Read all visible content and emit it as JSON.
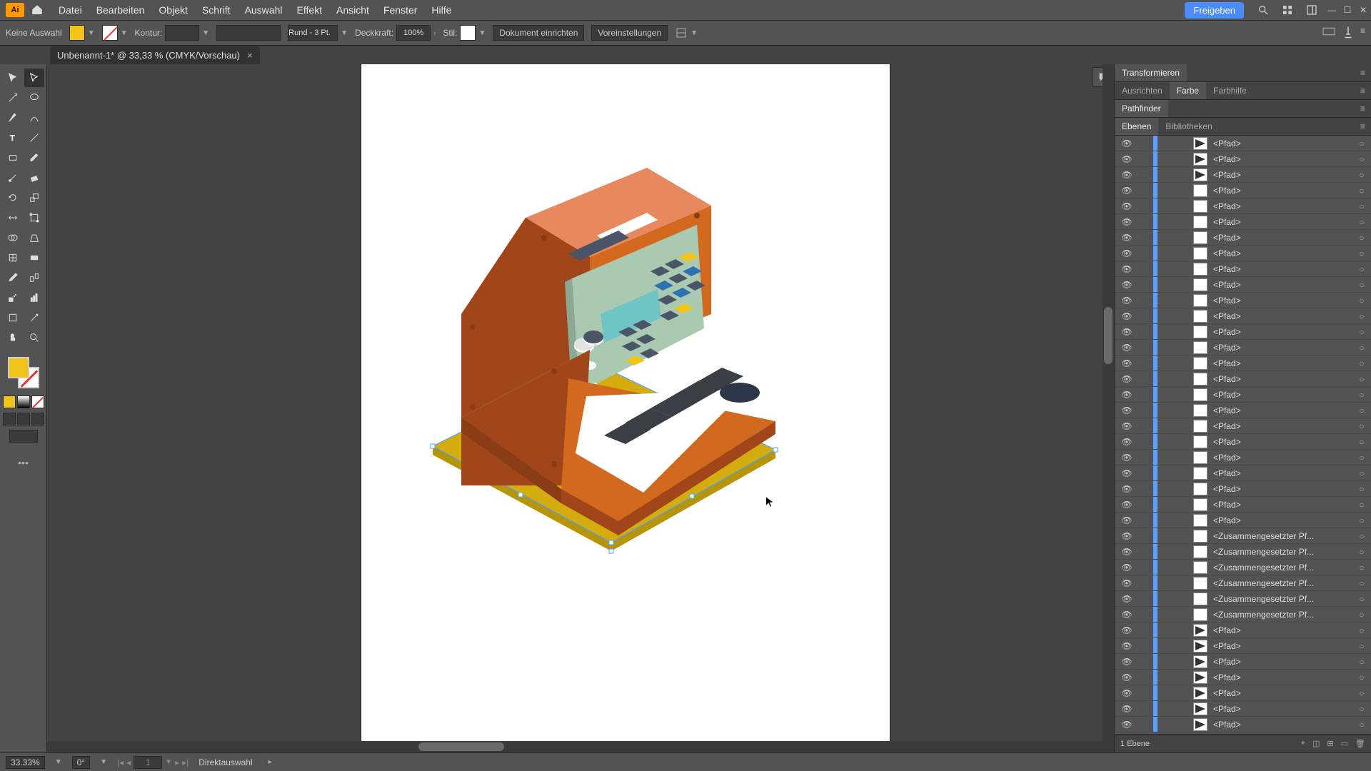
{
  "app": {
    "logo_letters": "Ai"
  },
  "menu": [
    "Datei",
    "Bearbeiten",
    "Objekt",
    "Schrift",
    "Auswahl",
    "Effekt",
    "Ansicht",
    "Fenster",
    "Hilfe"
  ],
  "share_label": "Freigeben",
  "controlbar": {
    "no_selection": "Keine Auswahl",
    "stroke_label": "Kontur:",
    "stroke_profile": "Rund - 3 Pt.",
    "opacity_label": "Deckkraft:",
    "opacity_value": "100%",
    "style_label": "Stil:",
    "doc_setup": "Dokument einrichten",
    "prefs": "Voreinstellungen"
  },
  "document_tab": {
    "title": "Unbenannt-1* @ 33,33 % (CMYK/Vorschau)",
    "close": "×"
  },
  "right_panels": {
    "row1": {
      "tab": "Transformieren"
    },
    "row2": {
      "tabs": [
        "Ausrichten",
        "Farbe",
        "Farbhilfe"
      ],
      "active": 1
    },
    "row3": {
      "tab": "Pathfinder"
    },
    "row4": {
      "tabs": [
        "Ebenen",
        "Bibliotheken"
      ],
      "active": 0
    }
  },
  "layers": [
    {
      "name": "<Pfad>",
      "thumb": "tri"
    },
    {
      "name": "<Pfad>",
      "thumb": "tri"
    },
    {
      "name": "<Pfad>",
      "thumb": "tri"
    },
    {
      "name": "<Pfad>",
      "thumb": ""
    },
    {
      "name": "<Pfad>",
      "thumb": ""
    },
    {
      "name": "<Pfad>",
      "thumb": ""
    },
    {
      "name": "<Pfad>",
      "thumb": ""
    },
    {
      "name": "<Pfad>",
      "thumb": ""
    },
    {
      "name": "<Pfad>",
      "thumb": ""
    },
    {
      "name": "<Pfad>",
      "thumb": ""
    },
    {
      "name": "<Pfad>",
      "thumb": ""
    },
    {
      "name": "<Pfad>",
      "thumb": ""
    },
    {
      "name": "<Pfad>",
      "thumb": ""
    },
    {
      "name": "<Pfad>",
      "thumb": ""
    },
    {
      "name": "<Pfad>",
      "thumb": ""
    },
    {
      "name": "<Pfad>",
      "thumb": ""
    },
    {
      "name": "<Pfad>",
      "thumb": ""
    },
    {
      "name": "<Pfad>",
      "thumb": ""
    },
    {
      "name": "<Pfad>",
      "thumb": ""
    },
    {
      "name": "<Pfad>",
      "thumb": ""
    },
    {
      "name": "<Pfad>",
      "thumb": ""
    },
    {
      "name": "<Pfad>",
      "thumb": ""
    },
    {
      "name": "<Pfad>",
      "thumb": ""
    },
    {
      "name": "<Pfad>",
      "thumb": ""
    },
    {
      "name": "<Pfad>",
      "thumb": ""
    },
    {
      "name": "<Zusammengesetzter Pf...",
      "thumb": ""
    },
    {
      "name": "<Zusammengesetzter Pf...",
      "thumb": ""
    },
    {
      "name": "<Zusammengesetzter Pf...",
      "thumb": ""
    },
    {
      "name": "<Zusammengesetzter Pf...",
      "thumb": ""
    },
    {
      "name": "<Zusammengesetzter Pf...",
      "thumb": ""
    },
    {
      "name": "<Zusammengesetzter Pf...",
      "thumb": ""
    },
    {
      "name": "<Pfad>",
      "thumb": "tri"
    },
    {
      "name": "<Pfad>",
      "thumb": "tri"
    },
    {
      "name": "<Pfad>",
      "thumb": "tri"
    },
    {
      "name": "<Pfad>",
      "thumb": "tri"
    },
    {
      "name": "<Pfad>",
      "thumb": "tri"
    },
    {
      "name": "<Pfad>",
      "thumb": "tri"
    },
    {
      "name": "<Pfad>",
      "thumb": "tri"
    }
  ],
  "layers_footer": "1 Ebene",
  "status": {
    "zoom": "33.33%",
    "rotation": "0°",
    "artboard": "1",
    "tool": "Direktauswahl"
  },
  "colors": {
    "orange": "#d2691e",
    "orange_dark": "#a0461a",
    "orange_light": "#e8885e",
    "yellow": "#d4ac0d",
    "yellow_dark": "#b7950b",
    "panel_green": "#a9c9b0",
    "panel_green_dark": "#8ca995",
    "screen": "#6fc5c5",
    "blue": "#2e70b2",
    "grey": "#4a5568",
    "grey_light": "#5a6a7a",
    "white": "#ffffff",
    "dark": "#2d3748"
  }
}
